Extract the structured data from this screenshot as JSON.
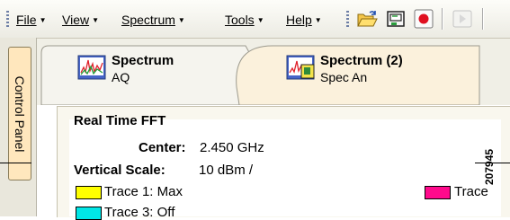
{
  "menubar": {
    "items": [
      {
        "label": "File"
      },
      {
        "label": "View"
      },
      {
        "label": "Spectrum"
      },
      {
        "label": "Tools"
      },
      {
        "label": "Help"
      }
    ]
  },
  "control_panel": {
    "label": "Control Panel"
  },
  "tabs": [
    {
      "title": "Spectrum",
      "subtitle": "AQ",
      "active": false
    },
    {
      "title": "Spectrum (2)",
      "subtitle": "Spec An",
      "active": true
    }
  ],
  "panel": {
    "heading": "Real Time FFT",
    "center_label": "Center:",
    "center_value": "2.450 GHz",
    "vscale_label": "Vertical Scale:",
    "vscale_value": "10 dBm /",
    "traces": [
      {
        "label": "Trace 1: Max",
        "color": "#ffff00"
      },
      {
        "label": "Trace",
        "color": "#ff0a8c"
      },
      {
        "label": "Trace 3: Off",
        "color": "#00e6e6"
      }
    ]
  },
  "figure_id": "207945"
}
